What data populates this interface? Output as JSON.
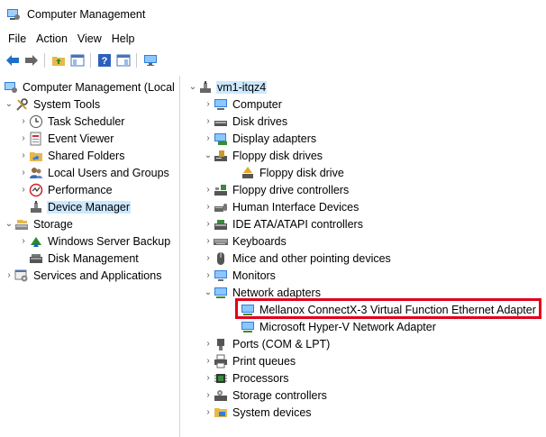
{
  "window": {
    "title": "Computer Management"
  },
  "menu": [
    "File",
    "Action",
    "View",
    "Help"
  ],
  "toolbar": [
    "back-icon",
    "forward-icon",
    "up-folder-icon",
    "show-hide-tree-icon",
    "help-icon",
    "properties-icon",
    "monitor-icon"
  ],
  "left_tree": {
    "root": "Computer Management (Local",
    "system_tools": "System Tools",
    "task_scheduler": "Task Scheduler",
    "event_viewer": "Event Viewer",
    "shared_folders": "Shared Folders",
    "local_users": "Local Users and Groups",
    "performance": "Performance",
    "device_manager": "Device Manager",
    "storage": "Storage",
    "windows_server_backup": "Windows Server Backup",
    "disk_management": "Disk Management",
    "services": "Services and Applications"
  },
  "right_tree": {
    "host": "vm1-itqz4",
    "computer": "Computer",
    "disk_drives": "Disk drives",
    "display_adapters": "Display adapters",
    "floppy_disk_drives": "Floppy disk drives",
    "floppy_disk_drive": "Floppy disk drive",
    "floppy_controllers": "Floppy drive controllers",
    "hid": "Human Interface Devices",
    "ide": "IDE ATA/ATAPI controllers",
    "keyboards": "Keyboards",
    "mice": "Mice and other pointing devices",
    "monitors": "Monitors",
    "network_adapters": "Network adapters",
    "mellanox": "Mellanox ConnectX-3 Virtual Function Ethernet Adapter",
    "hyperv": "Microsoft Hyper-V Network Adapter",
    "ports": "Ports (COM & LPT)",
    "print_queues": "Print queues",
    "processors": "Processors",
    "storage_controllers": "Storage controllers",
    "system_devices": "System devices"
  },
  "highlight_color": "#e2001a",
  "selection_color": "#cce8ff"
}
